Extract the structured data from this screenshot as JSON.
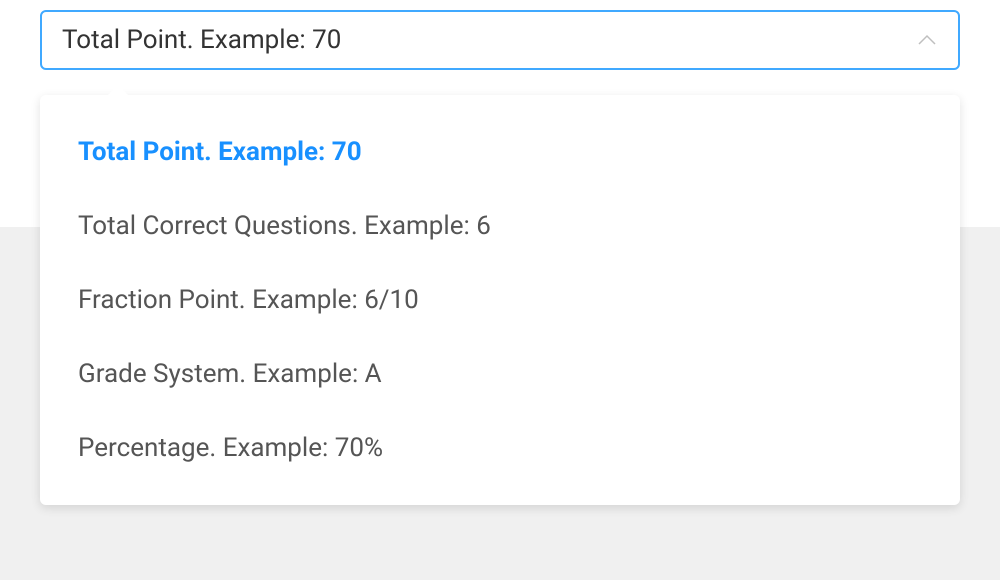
{
  "select": {
    "selected_value": "Total Point. Example: 70",
    "options": [
      {
        "label": "Total Point. Example: 70",
        "selected": true
      },
      {
        "label": "Total Correct Questions. Example: 6",
        "selected": false
      },
      {
        "label": "Fraction Point. Example: 6/10",
        "selected": false
      },
      {
        "label": "Grade System. Example: A",
        "selected": false
      },
      {
        "label": "Percentage. Example: 70%",
        "selected": false
      }
    ]
  }
}
